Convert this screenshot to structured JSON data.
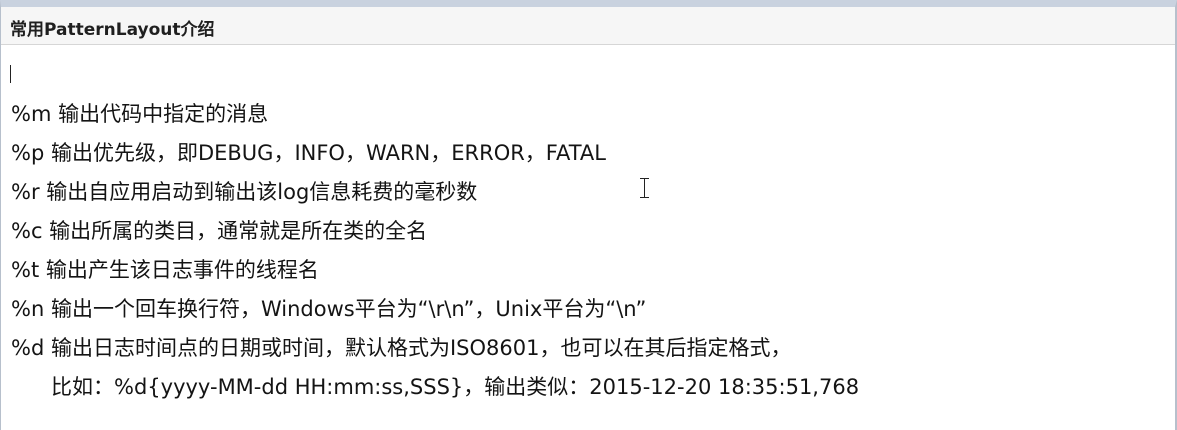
{
  "header": {
    "title": "常用PatternLayout介绍"
  },
  "lines": [
    "%m 输出代码中指定的消息",
    "%p 输出优先级，即DEBUG，INFO，WARN，ERROR，FATAL",
    "%r 输出自应用启动到输出该log信息耗费的毫秒数",
    "%c 输出所属的类目，通常就是所在类的全名",
    "%t 输出产生该日志事件的线程名",
    "%n 输出一个回车换行符，Windows平台为“\\r\\n”，Unix平台为“\\n”",
    "%d 输出日志时间点的日期或时间，默认格式为ISO8601，也可以在其后指定格式，",
    "比如：%d{yyyy-MM-dd HH:mm:ss,SSS}，输出类似：2015-12-20 18:35:51,768"
  ],
  "icons": {
    "text_cursor": "text-caret-icon",
    "mouse_pointer": "i-beam-cursor-icon"
  }
}
